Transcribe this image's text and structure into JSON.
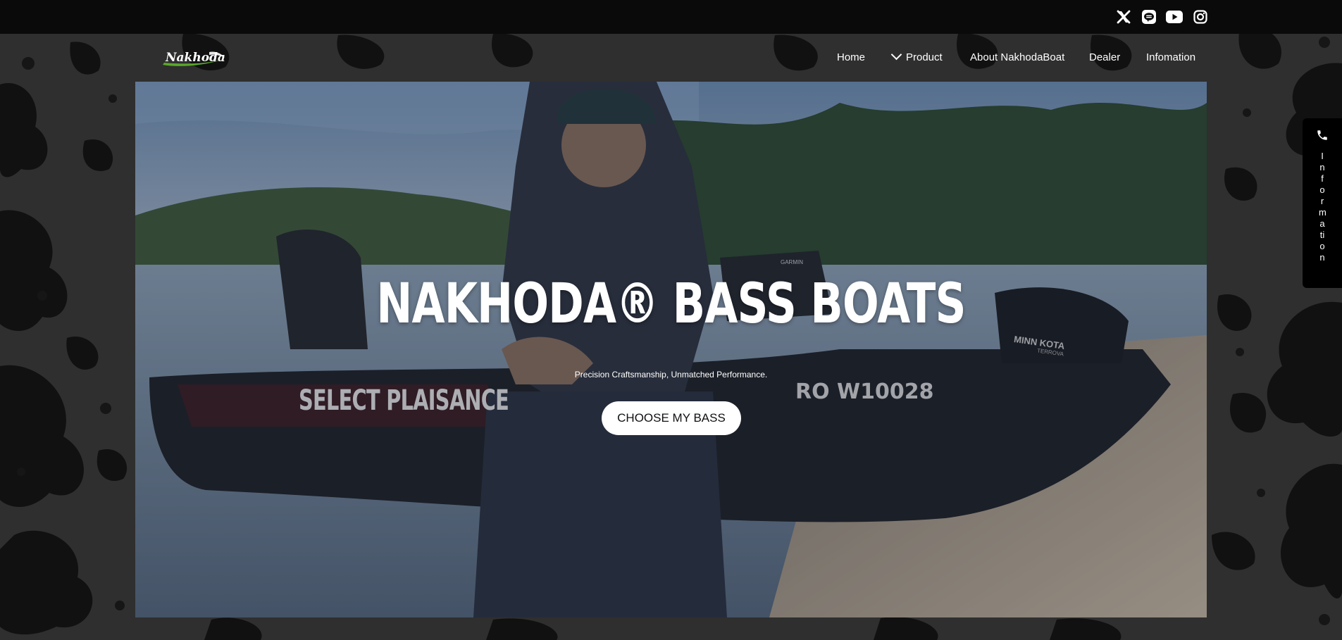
{
  "social": {
    "items": [
      {
        "name": "x",
        "icon": "x-twitter-icon"
      },
      {
        "name": "line",
        "icon": "line-chat-icon"
      },
      {
        "name": "youtube",
        "icon": "youtube-icon"
      },
      {
        "name": "instagram",
        "icon": "instagram-icon"
      }
    ]
  },
  "header": {
    "logo_text": "Nakhoda",
    "nav": [
      {
        "label": "Home"
      },
      {
        "label": "Product",
        "has_dropdown": true
      },
      {
        "label": "About NakhodaBoat"
      },
      {
        "label": "Dealer"
      },
      {
        "label": "Infomation"
      }
    ]
  },
  "hero": {
    "title": "NAKHODA® BASS BOATS",
    "subtitle": "Precision Craftsmanship, Unmatched Performance.",
    "cta_label": "CHOOSE MY BASS",
    "boat_hull_text": "SELECT PLAISANCE",
    "boat_registration": "RO W10028",
    "motor_brand": "MINN KOTA",
    "motor_model": "TERROVA",
    "electronics_brand": "GARMIN"
  },
  "side_tab": {
    "label": "Information",
    "icon": "phone-icon"
  },
  "colors": {
    "topbar": "#0a0a0a",
    "background": "#2f2f2f",
    "splatter": "#111111",
    "logo_green": "#5aa82a",
    "button_bg": "#ffffff"
  }
}
